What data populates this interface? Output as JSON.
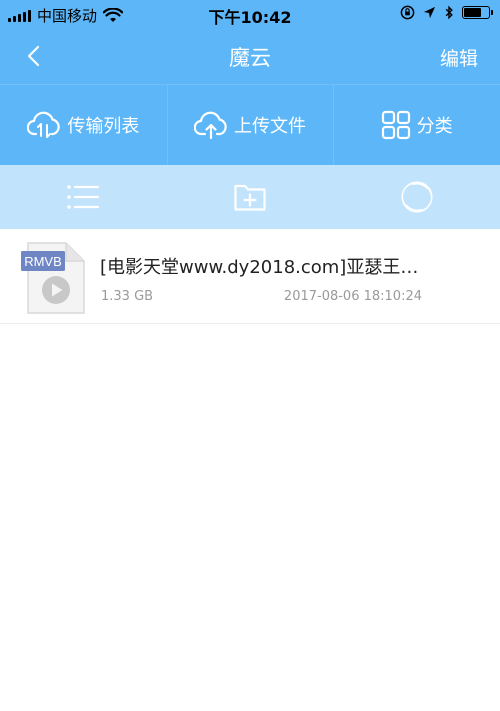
{
  "status_bar": {
    "carrier": "中国移动",
    "time": "下午10:42"
  },
  "nav": {
    "title": "魔云",
    "edit_label": "编辑"
  },
  "actions": [
    {
      "label": "传输列表",
      "icon": "cloud-transfer-icon"
    },
    {
      "label": "上传文件",
      "icon": "cloud-upload-icon"
    },
    {
      "label": "分类",
      "icon": "grid-icon"
    }
  ],
  "tools": [
    {
      "icon": "list-icon"
    },
    {
      "icon": "add-folder-icon"
    },
    {
      "icon": "refresh-icon"
    }
  ],
  "files": [
    {
      "type_badge": "RMVB",
      "name": "[电影天堂www.dy2018.com]亚瑟王…",
      "size": "1.33 GB",
      "date": "2017-08-06 18:10:24"
    }
  ],
  "colors": {
    "primary": "#5cb6f8",
    "toolbar": "#c2e3fc",
    "badge": "#6f86c4"
  }
}
